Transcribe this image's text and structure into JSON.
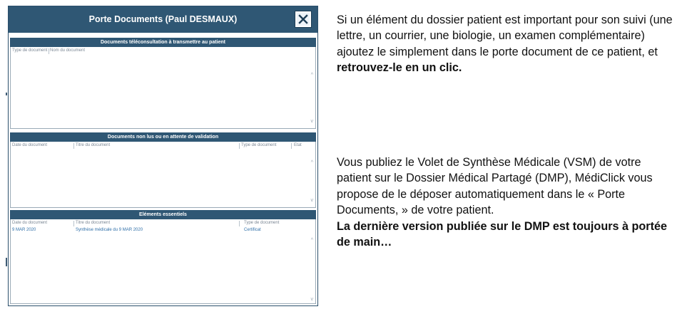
{
  "dialog": {
    "title": "Porte Documents (Paul DESMAUX)",
    "close_icon": "close-icon",
    "sections": [
      {
        "header": "Documents téléconsultation à transmettre au patient",
        "columns": [
          "Type de document",
          "Nom du document"
        ],
        "rows": []
      },
      {
        "header": "Documents non lus ou en attente de validation",
        "columns": [
          "Date du document",
          "Titre du document",
          "Type de document",
          "Etat"
        ],
        "rows": []
      },
      {
        "header": "Eléments essentiels",
        "columns": [
          "Date du document",
          "Titre du document",
          "Type de document"
        ],
        "rows": [
          {
            "date": "9 MAR 2020",
            "title": "Synthèse médicale du 9 MAR 2020",
            "type": "Certificat"
          }
        ]
      }
    ]
  },
  "scroll_up_glyph": "^",
  "scroll_down_glyph": "v",
  "paragraph1": {
    "text": "Si un élément du dossier patient est important pour son suivi (une lettre, un courrier, une biologie, un examen complémentaire) ajoutez le simplement dans le porte document de ce patient, et ",
    "bold": "retrouvez-le en un clic."
  },
  "paragraph2": {
    "text": "Vous publiez le Volet de Synthèse Médicale (VSM) de votre patient sur le Dossier Médical Partagé (DMP), MédiClick vous propose de le déposer automatiquement dans le « Porte Documents, » de votre patient.",
    "bold": "La dernière version publiée sur le DMP est toujours à portée de main…"
  }
}
